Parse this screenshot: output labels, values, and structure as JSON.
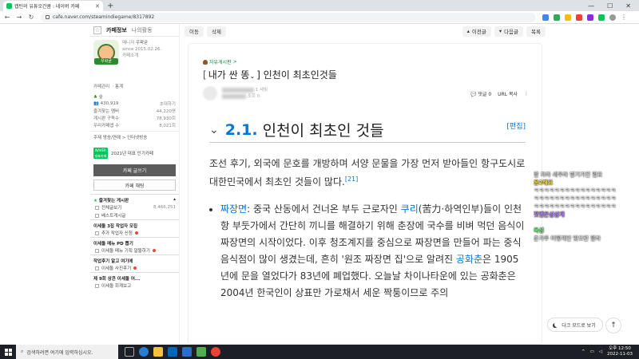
{
  "browser": {
    "tab_title": "캡틴의 유튜오간콤 : 네이버 카페",
    "url": "cafe.naver.com/steamindiegame/8317892"
  },
  "sidebar": {
    "tab_info": "카페정보",
    "tab_activity": "나의활동",
    "cafe_logo_label": "우왁굳",
    "manager_label": "매니저",
    "manager_name": "우왁굳",
    "since": "since 2015.02.26.",
    "cafe_desc": "카페소개",
    "links": "카페관리 ㆍ통계",
    "level": "숲",
    "members": "430,919",
    "invite": "초대하기",
    "stats": [
      {
        "label": "즐겨찾는 멤버",
        "value": "44,220명"
      },
      {
        "label": "게시판 구독수",
        "value": "78,930회"
      },
      {
        "label": "우리카페앱 수",
        "value": "8,021회"
      }
    ],
    "topic": "주제  방송/연예 > 인터넷방송",
    "award_badge": "NAVER 대표카페",
    "award_text": "2021년 대표 인기카페",
    "write_button": "카페 글쓰기",
    "chat_button": "카페 채팅",
    "favorites_title": "즐겨찾는 게시판",
    "favorites": [
      {
        "label": "전체글보기",
        "count": "8,466,251"
      },
      {
        "label": "베스트게시글",
        "count": ""
      }
    ],
    "section_notice": "이세돌 3집 작업자 모집",
    "notice_item": "추가 작업자 신청",
    "section_pd": "이세돌 메뉴 PD 뽑기",
    "pd_item": "이세돌 메뉴 기획 알뜰하기",
    "section_worker": "작업후기 알고 여기에",
    "worker_item": "이세돌 사진후기",
    "section_last": "제 9회 상콘 이세돌 어...",
    "last_item": "이세돌 회계보고"
  },
  "toolbar": {
    "move": "이동",
    "delete": "삭제",
    "prev": "이전글",
    "next": "다음글",
    "list": "목록"
  },
  "article": {
    "board": "자유게시판",
    "board_arrow": ">",
    "title_bracket_open": "[",
    "title_tag": "내가 싼 똥",
    "title_rest": "] 인천이 최초인것들",
    "author_level": "1 세빛",
    "author_meta": "조회 0",
    "comments": "댓글 0",
    "url_copy": "URL 복사",
    "more": "⋮"
  },
  "wiki": {
    "number": "2.1.",
    "heading": "인천이 최초인 것들",
    "edit": "[편집]",
    "intro": "조선 후기, 외국에 문호를 개방하며 서양 문물을 가장 먼저 받아들인 항구도시로 대한민국에서 최초인 것들이 많다.",
    "footnote": "[21]",
    "bullet_term": "짜장면",
    "bullet_seg1": ": 중국 산동에서 건너온 부두 근로자인 ",
    "bullet_link1": "쿠리",
    "bullet_seg2": "(苦力·하역인부)들이 인천항 부둣가에서 간단히 끼니를 해결하기 위해 춘장에 국수를 비벼 먹던 음식이 짜장면의 시작이었다. 이후 청조계지를 중심으로 짜장면을 만들어 파는 중식음식점이 많이 생겼는데, 흔히 '원조 짜장면 집'으로 알려진 ",
    "bullet_link2": "공화춘",
    "bullet_seg3": "은 1905년에 문을 열었다가 83년에 폐업했다. 오늘날 차이나타운에 있는 공화춘은 2004년 한국인이 상표만 가로채서 세운 짝퉁이므로 주의"
  },
  "floating": {
    "dark_mode": "다크 모드로 보기",
    "top": "↑"
  },
  "chat": [
    {
      "name": "",
      "text": "잘 자라 세우라 발기가진 필요",
      "color": "#ffffff"
    },
    {
      "name": "응2해요",
      "text": "",
      "color": "#ffe14d"
    },
    {
      "name": "",
      "text": "ㅋㅋㅋㅋㅋㅋㅋㅋㅋㅋㅋㅋㅋㅋㅋㅋ",
      "color": "#ffffff"
    },
    {
      "name": "",
      "text": "ㅋㅋㅋㅋㅋㅋㅋㅋㅋㅋㅋㅋㅋㅋㅋㅋ",
      "color": "#ffffff"
    },
    {
      "name": "",
      "text": "ㅋㅋㅋㅋㅋㅋㅋㅋㅋㅋㅋㅋㅋㅋㅋㅋ",
      "color": "#ffffff"
    },
    {
      "name": "젓엔은삼삼개",
      "text": "",
      "color": "#b98cff"
    },
    {
      "name": "",
      "text": "",
      "color": "#ffffff"
    },
    {
      "name": "옥성",
      "text": "",
      "color": "#7dff7d"
    },
    {
      "name": "",
      "text": "춘가주 어떻게인 맞으면 팔라",
      "color": "#ffffff"
    }
  ],
  "taskbar": {
    "search_placeholder": "검색하려면 여기에 입력하십시오.",
    "time": "오후 12:50",
    "date": "2022-11-03"
  },
  "colors": {
    "naver_green": "#03c75a",
    "wiki_blue": "#0275d8"
  }
}
